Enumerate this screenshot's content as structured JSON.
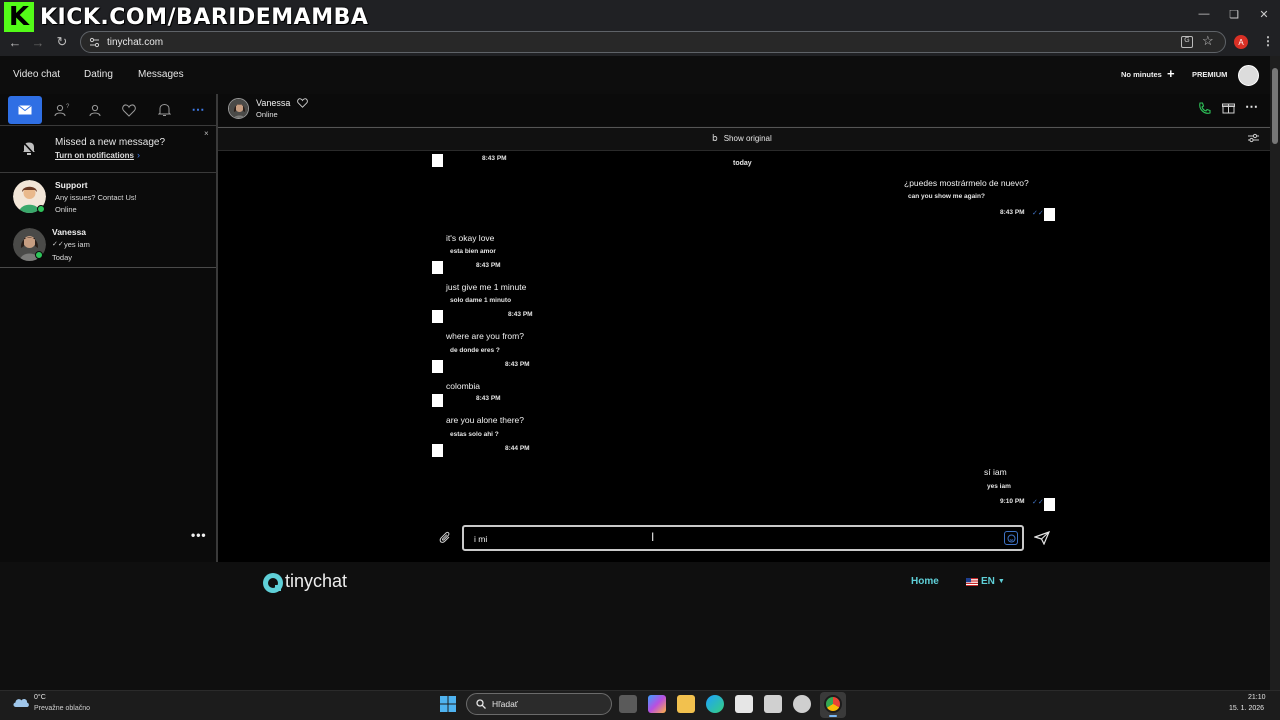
{
  "watermark": {
    "text": "KICK.COM/BARIDEMAMBA",
    "logo_letter": "K"
  },
  "browser": {
    "url": "tinychat.com",
    "profile_initial": "A"
  },
  "nav": {
    "video_chat": "Video chat",
    "dating": "Dating",
    "messages": "Messages",
    "no_minutes": "No minutes",
    "premium": "PREMIUM"
  },
  "notification": {
    "title": "Missed a new message?",
    "link": "Turn on notifications"
  },
  "conversations": [
    {
      "name": "Support",
      "line1": "Any issues? Contact Us!",
      "line2": "Online"
    },
    {
      "name": "Vanessa",
      "line1": "yes iam",
      "line2": "Today"
    }
  ],
  "chat": {
    "name": "Vanessa",
    "status": "Online",
    "show_original": "Show original",
    "day_separator": "today",
    "top_time": "8:43 PM",
    "messages": [
      {
        "side": "out",
        "text": "¿puedes mostrármelo de nuevo?",
        "translation": "can you show me again?",
        "time": "8:43 PM"
      },
      {
        "side": "in",
        "text": "it's okay love",
        "translation": "esta bien amor",
        "time": "8:43 PM"
      },
      {
        "side": "in",
        "text": "just give me 1 minute",
        "translation": "solo dame 1 minuto",
        "time": "8:43 PM"
      },
      {
        "side": "in",
        "text": "where are you from?",
        "translation": "de donde eres ?",
        "time": "8:43 PM"
      },
      {
        "side": "in",
        "text": "colombia",
        "translation": "",
        "time": "8:43 PM"
      },
      {
        "side": "in",
        "text": "are you alone there?",
        "translation": "estas solo ahi ?",
        "time": "8:44 PM"
      },
      {
        "side": "out",
        "text": "sí iam",
        "translation": "yes iam",
        "time": "9:10 PM"
      }
    ],
    "input_value": "i mi"
  },
  "footer": {
    "brand": "tinychat",
    "home": "Home",
    "lang": "EN"
  },
  "taskbar": {
    "temperature": "0°C",
    "weather": "Prevažne oblačno",
    "search": "Hľadať",
    "time": "21:10",
    "date": "15. 1. 2026"
  },
  "colors": {
    "accent_blue": "#2f6fe4",
    "online_green": "#2ec45a",
    "footer_link": "#5fd0d8",
    "kick_green": "#53fc18"
  }
}
